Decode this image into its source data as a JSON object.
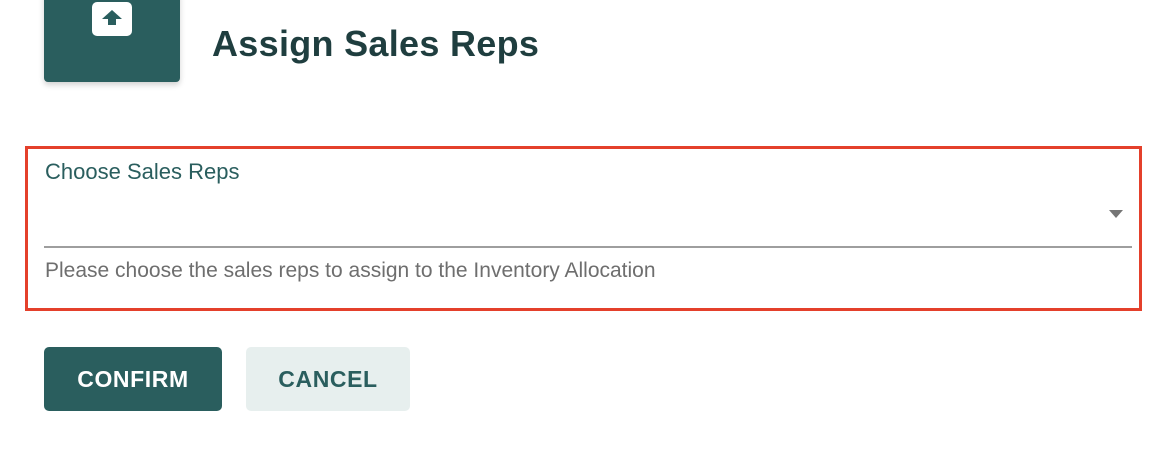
{
  "header": {
    "icon": "upload-arrow-icon",
    "title": "Assign Sales Reps"
  },
  "form": {
    "field": {
      "label": "Choose Sales Reps",
      "value": "",
      "dropdown_icon": "chevron-down-icon",
      "helper_text": "Please choose the sales reps to assign to the Inventory Allocation"
    }
  },
  "actions": {
    "confirm_label": "CONFIRM",
    "cancel_label": "CANCEL"
  },
  "colors": {
    "primary": "#2a5e5e",
    "secondary_bg": "#e7efee",
    "title_text": "#1f3e3f",
    "highlight_border": "#e4402b"
  }
}
